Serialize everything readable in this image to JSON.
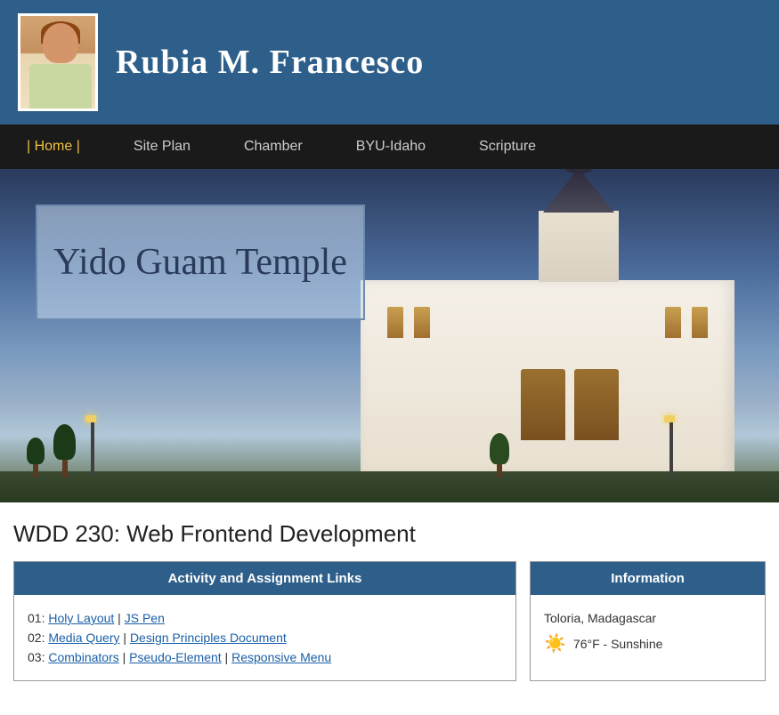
{
  "header": {
    "name": "Rubia M. Francesco",
    "avatar_alt": "Profile photo of Rubia M. Francesco"
  },
  "nav": {
    "items": [
      {
        "label": "| Home |",
        "active": true,
        "id": "home"
      },
      {
        "label": "Site Plan",
        "active": false,
        "id": "site-plan"
      },
      {
        "label": "Chamber",
        "active": false,
        "id": "chamber"
      },
      {
        "label": "BYU-Idaho",
        "active": false,
        "id": "byu-idaho"
      },
      {
        "label": "Scripture",
        "active": false,
        "id": "scripture"
      }
    ]
  },
  "hero": {
    "temple_name": "Yido Guam Temple"
  },
  "main": {
    "page_title": "WDD 230: Web Frontend Development",
    "left_column": {
      "header": "Activity and Assignment Links",
      "links": [
        {
          "number": "01",
          "items": [
            {
              "label": "Holy Layout",
              "url": "#"
            },
            {
              "label": "JS Pen",
              "url": "#"
            }
          ]
        },
        {
          "number": "02",
          "items": [
            {
              "label": "Media Query",
              "url": "#"
            },
            {
              "label": "Design Principles Document",
              "url": "#"
            }
          ]
        },
        {
          "number": "03",
          "items": [
            {
              "label": "Combinators",
              "url": "#"
            },
            {
              "label": "Pseudo-Element",
              "url": "#"
            },
            {
              "label": "Responsive Menu",
              "url": "#"
            }
          ]
        }
      ]
    },
    "right_column": {
      "header": "Information",
      "location": "Toloria, Madagascar",
      "weather": {
        "temp": "76°F - Sunshine",
        "icon": "☀️"
      }
    }
  }
}
